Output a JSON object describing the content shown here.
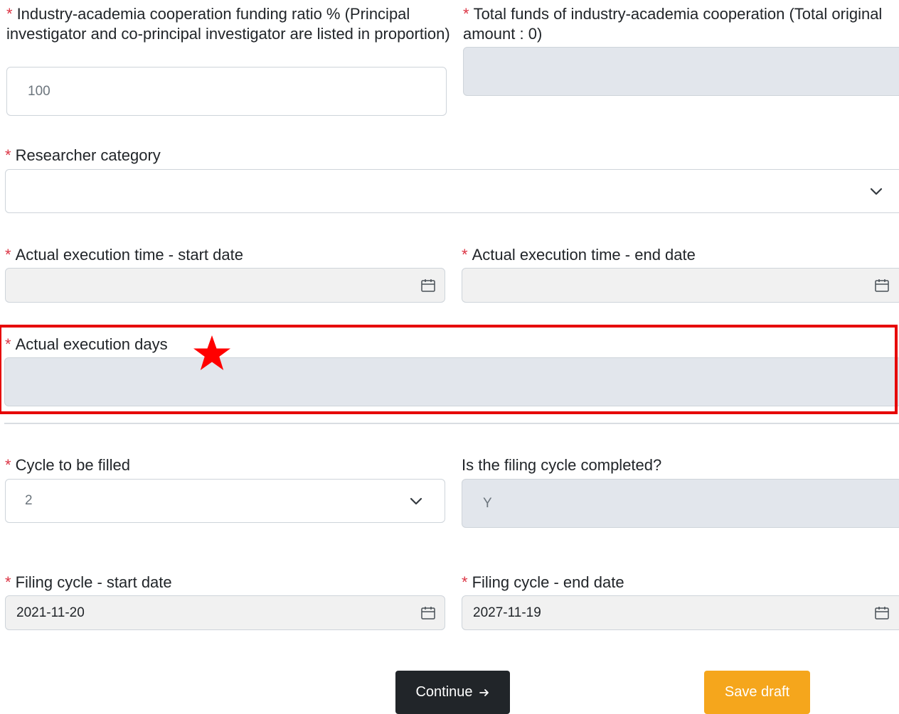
{
  "colors": {
    "required": "#dc3545",
    "highlight": "#e60000",
    "primary_button": "#212529",
    "draft_button": "#f5a61c"
  },
  "funding_ratio": {
    "label": "Industry-academia cooperation funding ratio % (Principal investigator and co-principal investigator are listed in proportion)",
    "value": "100"
  },
  "total_funds": {
    "label": "Total funds of industry-academia cooperation (Total original amount : 0)",
    "value": ""
  },
  "researcher_category": {
    "label": "Researcher category",
    "value": "",
    "icon": "chevron-down-icon"
  },
  "exec_start": {
    "label": "Actual execution time - start date",
    "value": "",
    "icon": "calendar-icon"
  },
  "exec_end": {
    "label": "Actual execution time - end date",
    "value": "",
    "icon": "calendar-icon"
  },
  "exec_days": {
    "label": "Actual execution days",
    "value": "",
    "marker_icon": "star-icon"
  },
  "cycle": {
    "label": "Cycle to be filled",
    "value": "2",
    "icon": "chevron-down-icon"
  },
  "cycle_completed": {
    "label": "Is the filing cycle completed?",
    "value": "Y"
  },
  "filing_start": {
    "label": "Filing cycle - start date",
    "value": "2021-11-20",
    "icon": "calendar-icon"
  },
  "filing_end": {
    "label": "Filing cycle - end date",
    "value": "2027-11-19",
    "icon": "calendar-icon"
  },
  "buttons": {
    "continue": "Continue",
    "continue_icon": "arrow-right-icon",
    "save_draft": "Save draft"
  },
  "required_marker": "*"
}
